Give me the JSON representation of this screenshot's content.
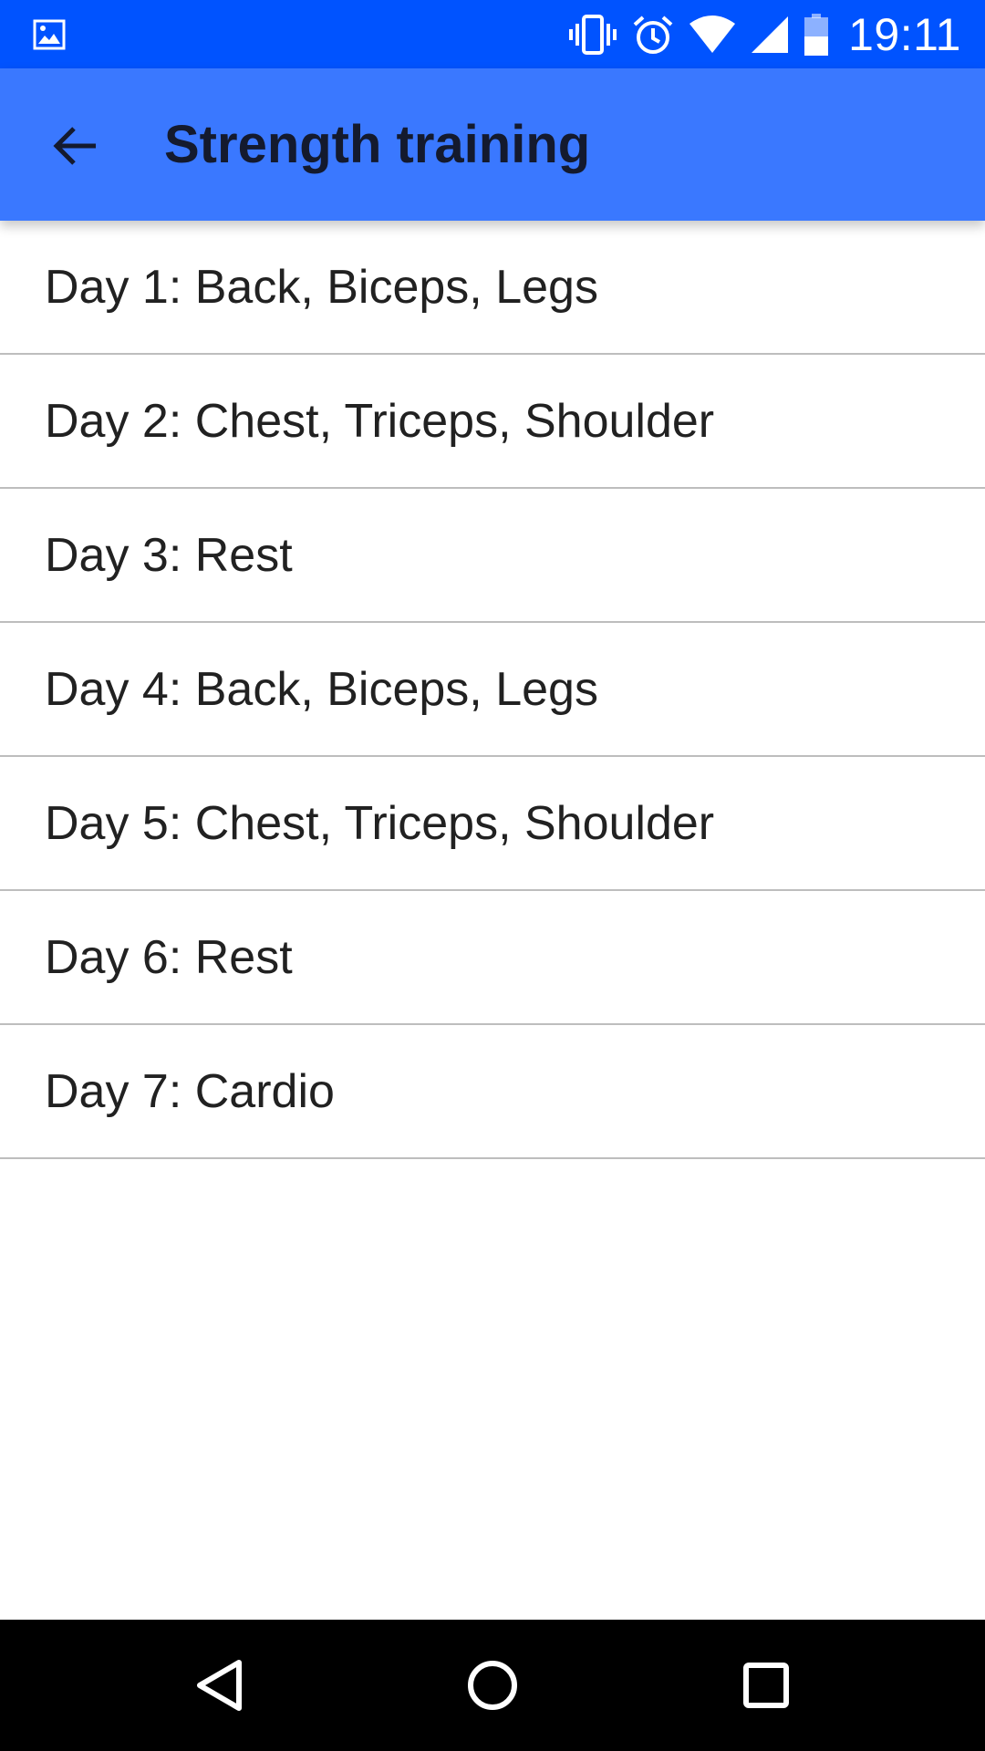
{
  "status_bar": {
    "time": "19:11",
    "background_color": "#0053ff",
    "icons": [
      "image-icon",
      "vibrate-icon",
      "alarm-icon",
      "wifi-icon",
      "cell-signal-icon",
      "battery-icon"
    ]
  },
  "app_bar": {
    "title": "Strength training",
    "background_color": "#3a78ff",
    "back_icon": "arrow-left-icon"
  },
  "list": {
    "items": [
      {
        "label": "Day 1: Back, Biceps, Legs"
      },
      {
        "label": "Day 2: Chest, Triceps, Shoulder"
      },
      {
        "label": "Day 3: Rest"
      },
      {
        "label": "Day 4: Back, Biceps, Legs"
      },
      {
        "label": "Day 5: Chest, Triceps, Shoulder"
      },
      {
        "label": "Day 6: Rest"
      },
      {
        "label": "Day 7: Cardio"
      }
    ]
  },
  "nav_bar": {
    "buttons": [
      "back-triangle-icon",
      "home-circle-icon",
      "recents-square-icon"
    ]
  }
}
